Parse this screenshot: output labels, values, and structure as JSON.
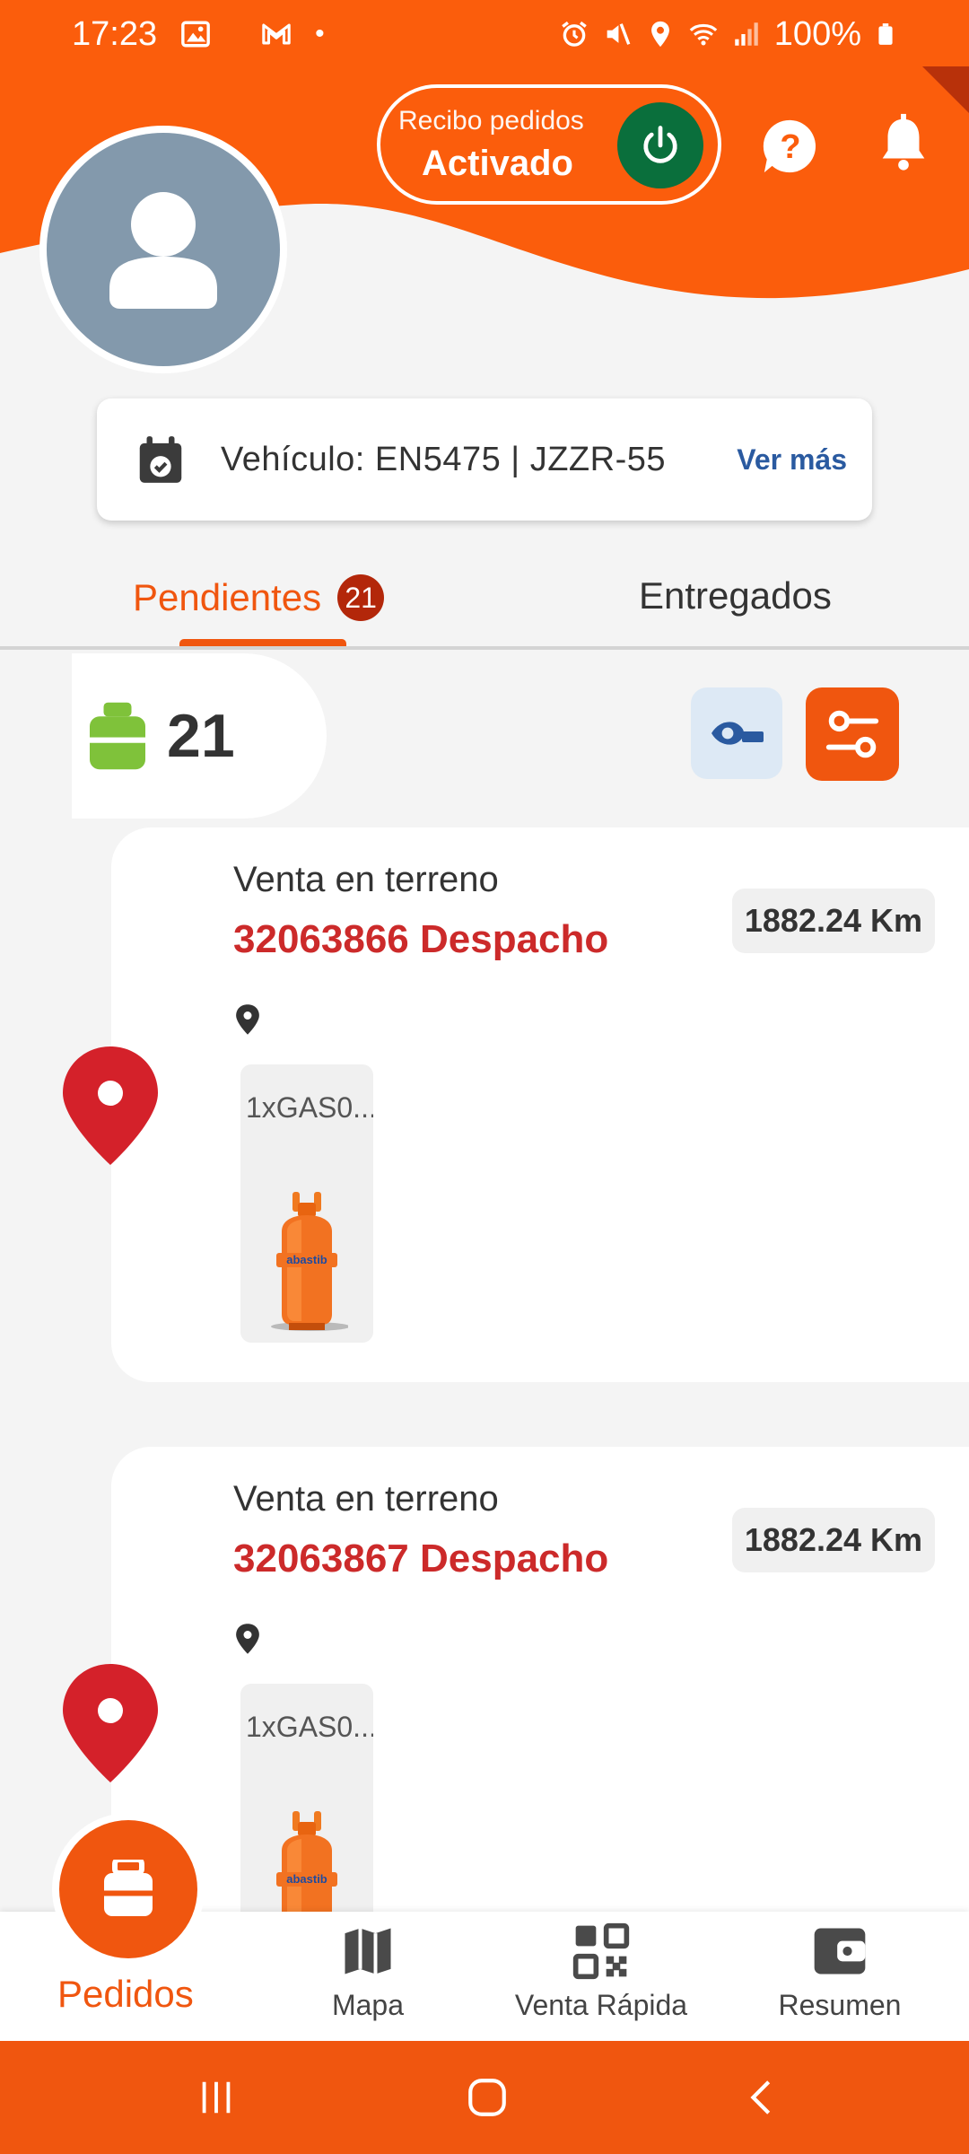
{
  "status_bar": {
    "time": "17:23",
    "dot": "•",
    "battery": "100%"
  },
  "header": {
    "toggle_caption": "Recibo pedidos",
    "toggle_state": "Activado",
    "help_icon": "help-icon",
    "bell_icon": "bell-icon"
  },
  "vehicle": {
    "label": "Vehículo: EN5475 | JZZR-55",
    "more": "Ver más"
  },
  "tabs": [
    {
      "label": "Pendientes",
      "badge": "21",
      "active": true
    },
    {
      "label": "Entregados",
      "active": false
    }
  ],
  "summary": {
    "count": "21"
  },
  "orders": [
    {
      "type": "Venta en terreno",
      "title": "32063866 Despacho",
      "distance": "1882.24 Km",
      "product": "1xGAS0..."
    },
    {
      "type": "Venta en terreno",
      "title": "32063867 Despacho",
      "distance": "1882.24 Km",
      "product": "1xGAS0..."
    }
  ],
  "bottom_nav": [
    {
      "label": "Pedidos",
      "active": true
    },
    {
      "label": "Mapa"
    },
    {
      "label": "Venta Rápida"
    },
    {
      "label": "Resumen"
    }
  ],
  "colors": {
    "accent": "#f0560f",
    "power": "#0a6f3c",
    "order_title": "#cc2a2a",
    "link": "#2a5aa0"
  }
}
